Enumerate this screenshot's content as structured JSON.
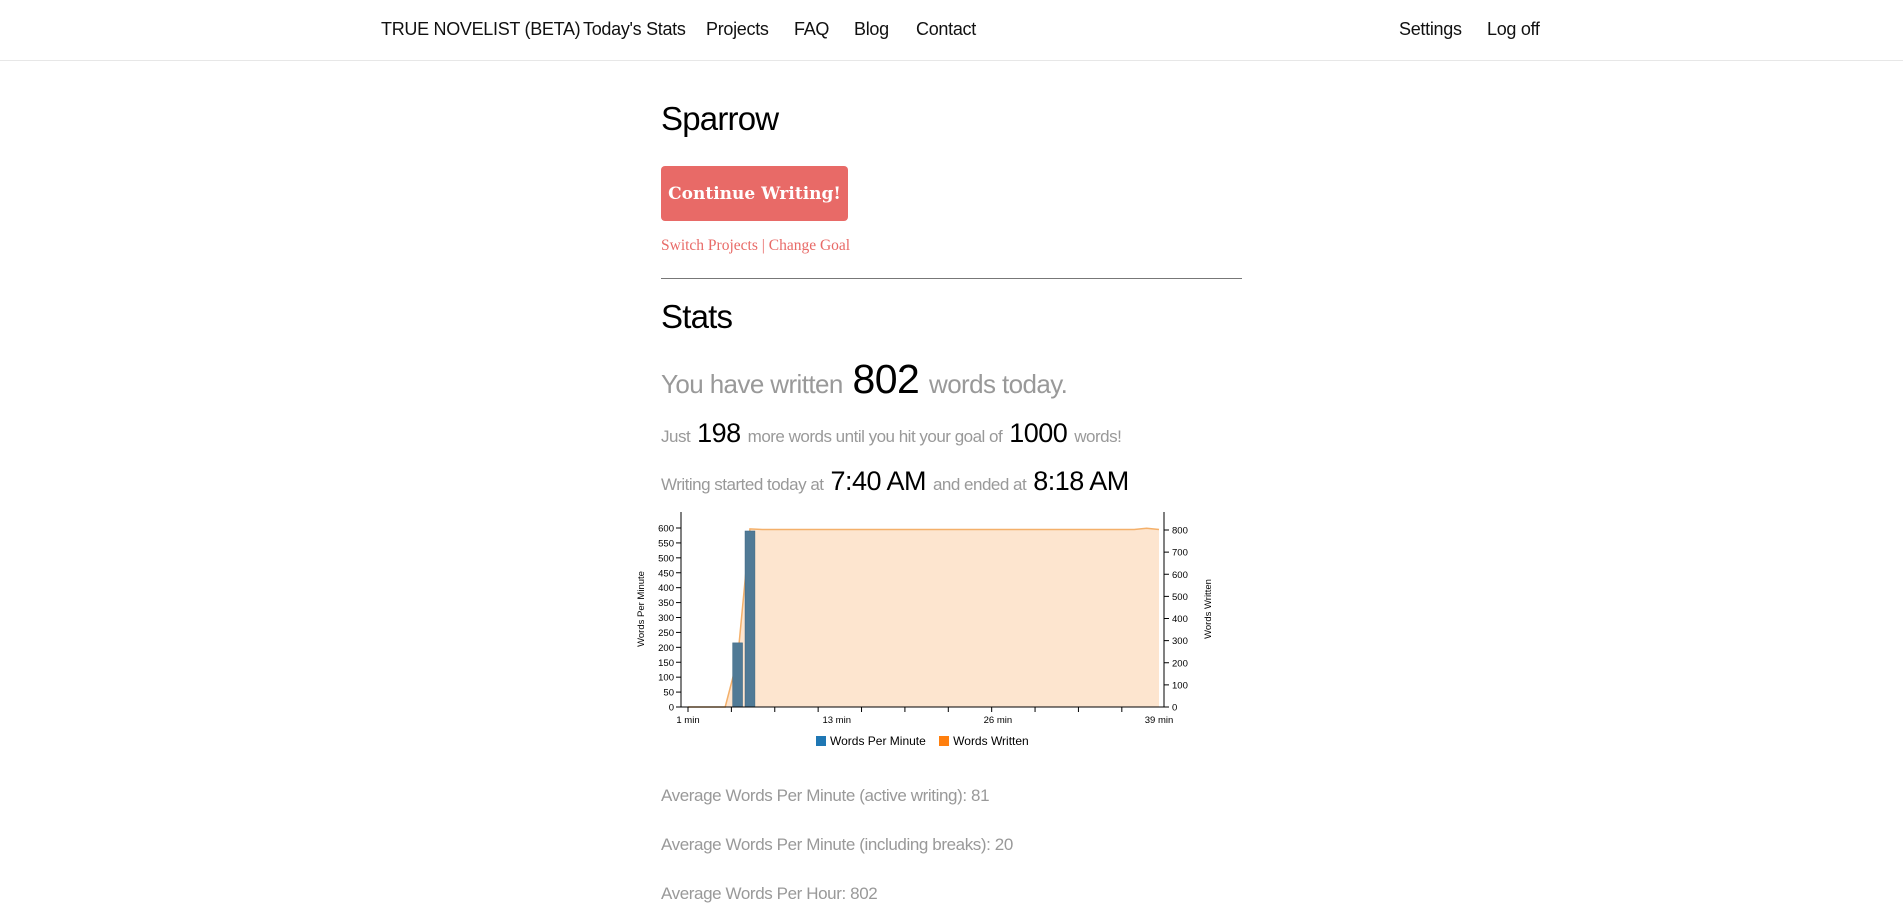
{
  "nav": {
    "brand": "TRUE NOVELIST (BETA)",
    "items": [
      "Today's Stats",
      "Projects",
      "FAQ",
      "Blog",
      "Contact"
    ],
    "right_items": [
      "Settings",
      "Log off"
    ]
  },
  "project": {
    "title": "Sparrow",
    "continue_label": "Continue Writing!",
    "switch_label": "Switch Projects",
    "separator": "|",
    "change_goal_label": "Change Goal"
  },
  "stats": {
    "title": "Stats",
    "written_prefix": "You have written",
    "words_today": "802",
    "written_suffix": "words today.",
    "just_prefix": "Just",
    "remaining": "198",
    "remaining_mid": "more words until you hit your goal of",
    "goal": "1000",
    "goal_suffix": "words!",
    "started_prefix": "Writing started today at",
    "start_time": "7:40 AM",
    "ended_mid": "and ended at",
    "end_time": "8:18 AM",
    "avg_active": "Average Words Per Minute (active writing): 81",
    "avg_breaks": "Average Words Per Minute (including breaks): 20",
    "avg_hour": "Average Words Per Hour: 802"
  },
  "chart_data": {
    "type": "bar",
    "x_tick_labels": [
      "1 min",
      "13 min",
      "26 min",
      "39 min"
    ],
    "x_range": [
      1,
      39
    ],
    "ylabel_left": "Words Per Minute",
    "ylabel_right": "Words Written",
    "ylim_left": [
      0,
      600
    ],
    "ylim_right": [
      0,
      800
    ],
    "yticks_left": [
      0,
      50,
      100,
      150,
      200,
      250,
      300,
      350,
      400,
      450,
      500,
      550,
      600
    ],
    "yticks_right": [
      0,
      100,
      200,
      300,
      400,
      500,
      600,
      700,
      800
    ],
    "series": [
      {
        "name": "Words Per Minute",
        "type": "bar",
        "color": "#1f77b4",
        "points": [
          [
            5,
            215
          ],
          [
            6,
            590
          ]
        ]
      },
      {
        "name": "Words Written",
        "type": "area",
        "color": "#ff7f0e",
        "points": [
          [
            1,
            0
          ],
          [
            4,
            0
          ],
          [
            5,
            215
          ],
          [
            6,
            805
          ],
          [
            7,
            802
          ],
          [
            20,
            802
          ],
          [
            37,
            802
          ],
          [
            38,
            808
          ],
          [
            39,
            802
          ]
        ]
      }
    ],
    "colors": {
      "bar_fill": "#507a96",
      "area_fill": "#fde5cf",
      "area_line": "#f4b06a"
    },
    "legend_position": "bottom-center"
  }
}
